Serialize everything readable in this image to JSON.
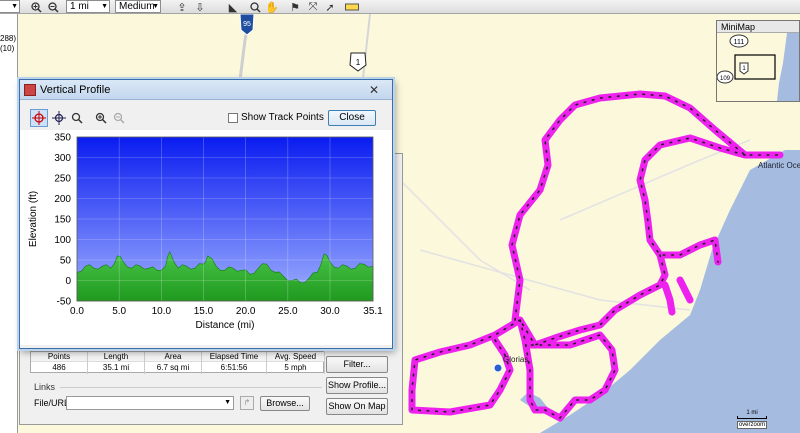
{
  "toolbar": {
    "zoom_in_icon": "zoom-in-icon",
    "zoom_out_icon": "zoom-out-icon",
    "scale_value": "1 mi",
    "detail_value": "Medium"
  },
  "left_panel": {
    "count_1": "288)",
    "count_2": "(10)"
  },
  "map": {
    "highway_95": "95",
    "route_1": "1",
    "place_label": "Atlantic Ocea",
    "waypoint_label": "Glorias",
    "scale_label": "1 mi",
    "overzoom_label": "overzoom",
    "colors": {
      "land": "#fbf8dc",
      "water": "#a5bce0",
      "track": "#ee22ee",
      "road": "#cfcfcf"
    }
  },
  "minimap": {
    "title": "MiniMap",
    "shield_111": "111",
    "shield_1": "1",
    "shield_109": "109"
  },
  "vertical_profile": {
    "title": "Vertical Profile",
    "show_track_points_label": "Show Track Points",
    "close_button": "Close"
  },
  "chart_data": {
    "type": "area",
    "xlabel": "Distance   (mi)",
    "ylabel": "Elevation (ft)",
    "xlim": [
      0,
      35.1
    ],
    "ylim": [
      -50,
      350
    ],
    "x_ticks": [
      "0.0",
      "5.0",
      "10.0",
      "15.0",
      "20.0",
      "25.0",
      "30.0",
      "35.1"
    ],
    "y_ticks": [
      "350",
      "300",
      "250",
      "200",
      "150",
      "100",
      "50",
      "0",
      "-50"
    ],
    "grid": true,
    "x": [
      0,
      1,
      2,
      3,
      4,
      4.8,
      5.5,
      6.5,
      7.5,
      8.5,
      9.5,
      10.5,
      11,
      12,
      13,
      14,
      15,
      15.5,
      16.5,
      17.5,
      18.5,
      19.5,
      20.5,
      21.5,
      22.5,
      23.5,
      24.5,
      25.5,
      26.5,
      27.5,
      28.5,
      29.3,
      30,
      31,
      32,
      33,
      34,
      35.1
    ],
    "y": [
      20,
      35,
      30,
      35,
      30,
      60,
      45,
      30,
      35,
      30,
      25,
      35,
      70,
      30,
      35,
      30,
      40,
      60,
      35,
      25,
      30,
      25,
      15,
      30,
      40,
      20,
      10,
      0,
      -5,
      5,
      20,
      65,
      45,
      30,
      35,
      30,
      40,
      35
    ],
    "colors": {
      "sky": "#0a1cf0",
      "sky_bottom": "#9fb0ff",
      "terrain": "#1f9a1f",
      "terrain_light": "#49c449"
    }
  },
  "properties": {
    "headers": [
      "Points",
      "Length",
      "Area",
      "Elapsed Time",
      "Avg. Speed"
    ],
    "values": [
      "486",
      "35.1 mi",
      "6.7 sq mi",
      "6:51:56",
      "5 mph"
    ],
    "filter_button": "Filter...",
    "show_profile_button": "Show Profile...",
    "show_on_map_button": "Show On Map",
    "links_label": "Links",
    "file_url_label": "File/URL:",
    "browse_button": "Browse..."
  }
}
